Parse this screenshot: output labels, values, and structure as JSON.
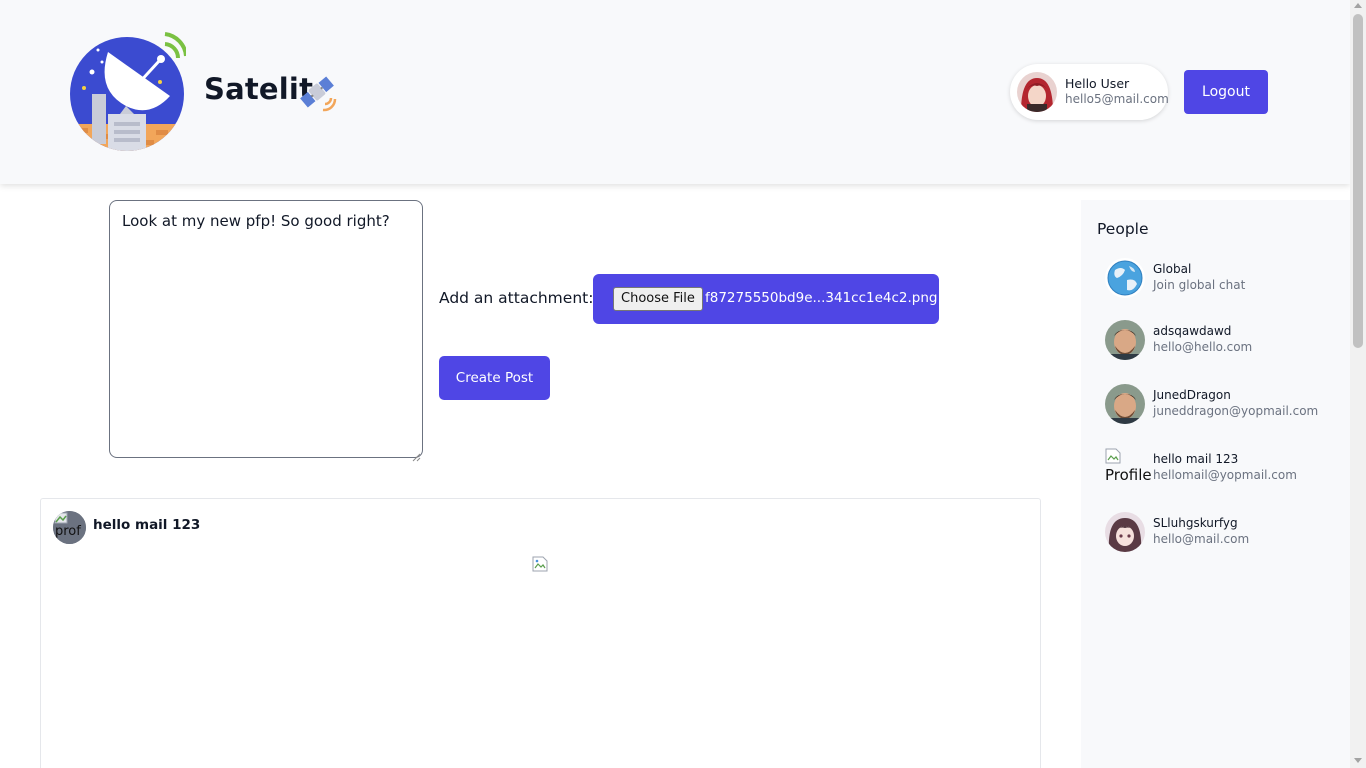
{
  "header": {
    "brand_name": "Satelit",
    "logo_icon": "satellite-dish-logo-icon",
    "brand_icon": "satellite-icon",
    "user": {
      "greeting": "Hello User",
      "email": "hello5@mail.com"
    },
    "logout_label": "Logout"
  },
  "compose": {
    "text": "Look at my new pfp! So good right?",
    "attachment_label": "Add an attachment:",
    "choose_file_label": "Choose File",
    "file_name": "f87275550bd9e...341cc1e4c2.png",
    "create_label": "Create Post"
  },
  "post": {
    "avatar_alt": "prof",
    "author": "hello mail 123"
  },
  "sidebar": {
    "title": "People",
    "people": [
      {
        "name": "Global",
        "email": "Join global chat"
      },
      {
        "name": "adsqawdawd",
        "email": "hello@hello.com"
      },
      {
        "name": "JunedDragon",
        "email": "juneddragon@yopmail.com"
      },
      {
        "name": "hello mail 123",
        "email": "hellomail@yopmail.com",
        "avatar_alt": "Profile"
      },
      {
        "name": "SLluhgskurfyg",
        "email": "hello@mail.com"
      }
    ]
  },
  "colors": {
    "accent": "#4f46e5",
    "header_bg": "#f8f9fb",
    "muted_text": "#6b7280"
  }
}
